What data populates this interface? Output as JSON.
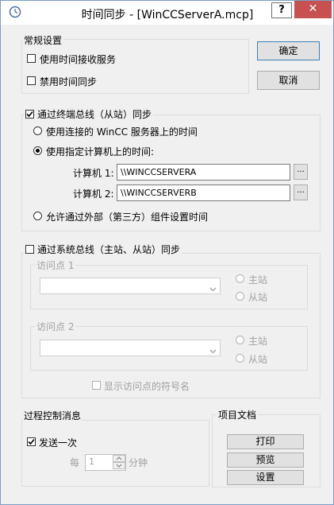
{
  "window": {
    "title": "时间同步 - [WinCCServerA.mcp]",
    "help_label": "?",
    "close_label": "✕"
  },
  "general": {
    "label": "常规设置",
    "receive_service": "使用时间接收服务",
    "disable_sync": "禁用时间同步"
  },
  "buttons": {
    "ok": "确定",
    "cancel": "取消"
  },
  "terminal": {
    "label": "通过终端总线（从站）同步",
    "use_connected": "使用连接的 WinCC 服务器上的时间",
    "use_specified": "使用指定计算机上的时间:",
    "computer1_label": "计算机 1:",
    "computer1_value": "\\\\WINCCSERVERA",
    "computer2_label": "计算机 2:",
    "computer2_value": "\\\\WINCCSERVERB",
    "browse_label": "...",
    "allow_external": "允许通过外部（第三方）组件设置时间"
  },
  "system": {
    "label": "通过系统总线（主站、从站）同步",
    "access_point1": "访问点 1",
    "access_point2": "访问点 2",
    "master": "主站",
    "slave": "从站",
    "show_symbolic": "显示访问点的符号名"
  },
  "process": {
    "label": "过程控制消息",
    "send_once": "发送一次",
    "every": "每",
    "interval_value": "1",
    "unit": "分钟"
  },
  "project": {
    "label": "项目文档",
    "print": "打印",
    "preview": "预览",
    "settings": "设置"
  },
  "colors": {
    "close_button": "#c75050",
    "window_bg": "#f0f0f0",
    "default_button_border": "#3c7fb1"
  }
}
